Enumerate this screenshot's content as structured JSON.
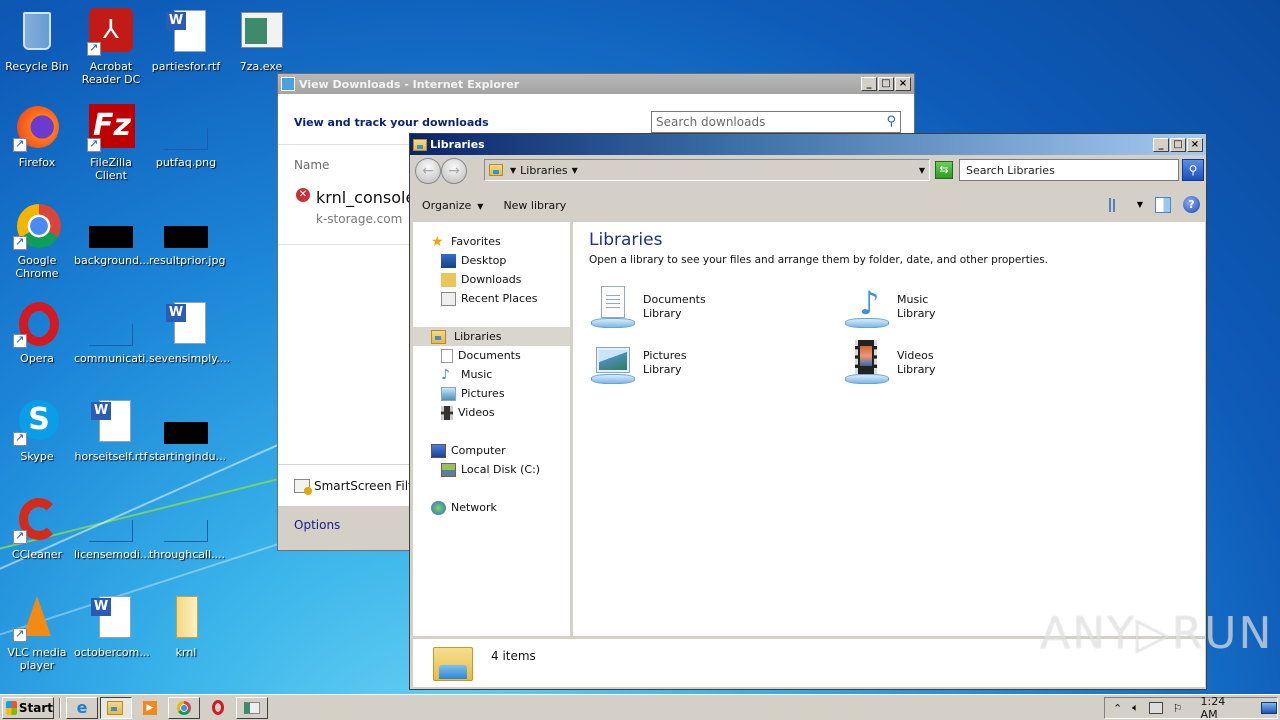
{
  "desktop": {
    "icons": [
      {
        "label": "Recycle Bin",
        "icon": "recycle-bin-icon",
        "shortcut": false
      },
      {
        "label": "Acrobat Reader DC",
        "icon": "acrobat-icon",
        "shortcut": true
      },
      {
        "label": "partiesfor.rtf",
        "icon": "word-document-icon",
        "shortcut": false
      },
      {
        "label": "7za.exe",
        "icon": "exe-window-icon",
        "shortcut": false
      },
      {
        "label": "Firefox",
        "icon": "firefox-icon",
        "shortcut": true
      },
      {
        "label": "FileZilla Client",
        "icon": "filezilla-icon",
        "shortcut": true
      },
      {
        "label": "putfaq.png",
        "icon": "image-file-icon",
        "shortcut": false
      },
      {
        "label": "Google Chrome",
        "icon": "chrome-icon",
        "shortcut": true
      },
      {
        "label": "background...",
        "icon": "image-file-icon",
        "shortcut": false
      },
      {
        "label": "resultprior.jpg",
        "icon": "image-file-icon",
        "shortcut": false
      },
      {
        "label": "Opera",
        "icon": "opera-icon",
        "shortcut": true
      },
      {
        "label": "communicati...",
        "icon": "image-file-icon",
        "shortcut": false
      },
      {
        "label": "sevensimply....",
        "icon": "word-document-icon",
        "shortcut": false
      },
      {
        "label": "Skype",
        "icon": "skype-icon",
        "shortcut": true
      },
      {
        "label": "horseitself.rtf",
        "icon": "word-document-icon",
        "shortcut": false
      },
      {
        "label": "startingindu...",
        "icon": "image-file-icon",
        "shortcut": false
      },
      {
        "label": "CCleaner",
        "icon": "ccleaner-icon",
        "shortcut": true
      },
      {
        "label": "licensemodi...",
        "icon": "image-file-icon",
        "shortcut": false
      },
      {
        "label": "throughcall....",
        "icon": "image-file-icon",
        "shortcut": false
      },
      {
        "label": "VLC media player",
        "icon": "vlc-icon",
        "shortcut": true
      },
      {
        "label": "octobercom...",
        "icon": "word-document-icon",
        "shortcut": false
      },
      {
        "label": "krnl",
        "icon": "folder-icon",
        "shortcut": false
      }
    ]
  },
  "ie_downloads": {
    "title": "View Downloads - Internet Explorer",
    "heading": "View and track your downloads",
    "search_placeholder": "Search downloads",
    "column_name": "Name",
    "items": [
      {
        "name": "krnl_console",
        "source": "k-storage.com",
        "status_icon": "blocked-shield-icon"
      }
    ],
    "smartscreen_label": "SmartScreen Filte",
    "options_label": "Options"
  },
  "libraries": {
    "title": "Libraries",
    "address": {
      "root_arrow": "▸",
      "crumb": "Libraries"
    },
    "search_placeholder": "Search Libraries",
    "toolbar": {
      "organize": "Organize",
      "new_library": "New library"
    },
    "nav": {
      "favorites": "Favorites",
      "favorites_items": [
        "Desktop",
        "Downloads",
        "Recent Places"
      ],
      "libraries": "Libraries",
      "libraries_items": [
        "Documents",
        "Music",
        "Pictures",
        "Videos"
      ],
      "computer": "Computer",
      "computer_items": [
        "Local Disk (C:)"
      ],
      "network": "Network"
    },
    "heading": "Libraries",
    "description": "Open a library to see your files and arrange them by folder, date, and other properties.",
    "items": [
      {
        "name": "Documents",
        "type": "Library"
      },
      {
        "name": "Music",
        "type": "Library"
      },
      {
        "name": "Pictures",
        "type": "Library"
      },
      {
        "name": "Videos",
        "type": "Library"
      }
    ],
    "status": "4 items"
  },
  "watermark": "ANY▷RUN",
  "taskbar": {
    "start_label": "Start",
    "buttons": [
      "internet-explorer",
      "windows-explorer",
      "media-player",
      "chrome",
      "opera",
      "7za-window"
    ],
    "clock": "1:24 AM"
  }
}
